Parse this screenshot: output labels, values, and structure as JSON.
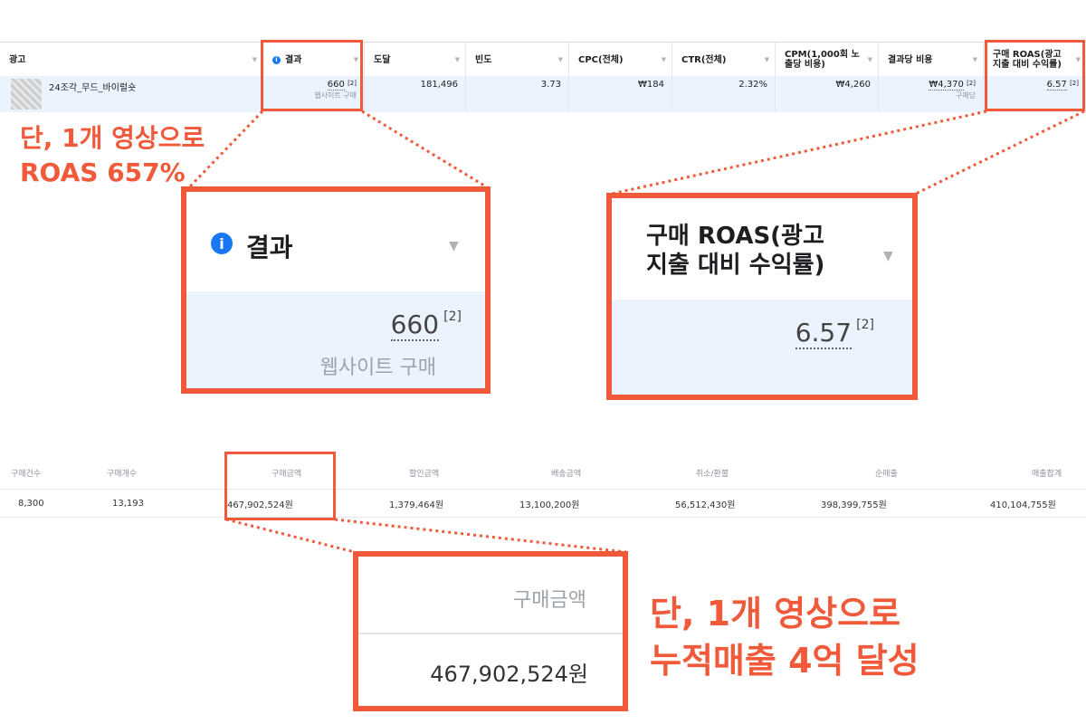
{
  "ads_table": {
    "columns": [
      {
        "label": "광고"
      },
      {
        "label": "결과",
        "icon": "info-icon"
      },
      {
        "label": "도달"
      },
      {
        "label": "빈도"
      },
      {
        "label": "CPC(전체)"
      },
      {
        "label": "CTR(전체)"
      },
      {
        "label": "CPM(1,000회 노출당 비용)"
      },
      {
        "label": "결과당 비용"
      },
      {
        "label": "구매 ROAS(광고 지출 대비 수익률)"
      }
    ],
    "row": {
      "ad_name": "24조각_무드_바이럴숏",
      "result": "660",
      "result_note": "[2]",
      "result_sub": "웹사이트 구매",
      "reach": "181,496",
      "frequency": "3.73",
      "cpc": "₩184",
      "ctr": "2.32%",
      "cpm": "₩4,260",
      "cost_per_result": "₩4,370",
      "cost_per_result_note": "[2]",
      "cost_per_result_sub": "구매당",
      "roas": "6.57",
      "roas_note": "[2]"
    }
  },
  "callouts": {
    "roas_line1": "단, 1개 영상으로",
    "roas_line2": "ROAS 657%",
    "sales_line1": "단, 1개 영상으로",
    "sales_line2": "누적매출 4억 달성"
  },
  "zoom_result": {
    "header": "결과",
    "value": "660",
    "note": "[2]",
    "sub": "웹사이트 구매"
  },
  "zoom_roas": {
    "header_line1": "구매 ROAS(광고",
    "header_line2": "지출 대비 수익률)",
    "value": "6.57",
    "note": "[2]"
  },
  "sales_table": {
    "headers": [
      "구매건수",
      "구매개수",
      "구매금액",
      "할인금액",
      "배송금액",
      "취소/환불",
      "순매출",
      "매출합계"
    ],
    "values": [
      "8,300",
      "13,193",
      "467,902,524원",
      "1,379,464원",
      "13,100,200원",
      "56,512,430원",
      "398,399,755원",
      "410,104,755원"
    ]
  },
  "zoom_sales": {
    "header": "구매금액",
    "value": "467,902,524원"
  },
  "colors": {
    "accent": "#f05a3a",
    "row_highlight": "#ebf3fe",
    "info_blue": "#1877f2"
  }
}
